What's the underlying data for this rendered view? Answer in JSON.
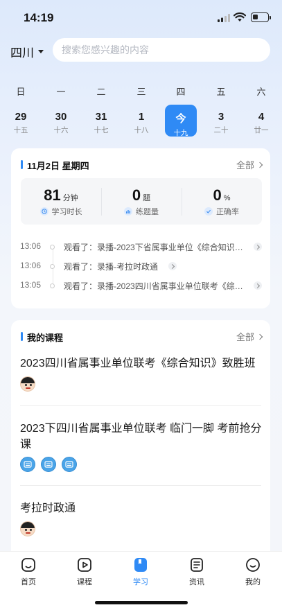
{
  "status_bar": {
    "time": "14:19"
  },
  "header": {
    "region": "四川",
    "search_placeholder": "搜索您感兴趣的内容"
  },
  "calendar": {
    "weekdays": [
      "日",
      "一",
      "二",
      "三",
      "四",
      "五",
      "六"
    ],
    "days": [
      {
        "day": "29",
        "lunar": "十五"
      },
      {
        "day": "30",
        "lunar": "十六"
      },
      {
        "day": "31",
        "lunar": "十七"
      },
      {
        "day": "1",
        "lunar": "十八"
      },
      {
        "day": "今",
        "lunar": "十九",
        "selected": true
      },
      {
        "day": "3",
        "lunar": "二十"
      },
      {
        "day": "4",
        "lunar": "廿一"
      }
    ]
  },
  "study_card": {
    "date_title": "11月2日  星期四",
    "all_label": "全部",
    "stats": [
      {
        "value": "81",
        "unit": "分钟",
        "label": "学习时长",
        "icon": "clock-icon"
      },
      {
        "value": "0",
        "unit": "题",
        "label": "练题量",
        "icon": "bar-chart-icon"
      },
      {
        "value": "0",
        "unit": "%",
        "label": "正确率",
        "icon": "check-icon"
      }
    ],
    "history": [
      {
        "time": "13:06",
        "text": "观看了：录播-2023下省属事业单位《综合知识》..."
      },
      {
        "time": "13:06",
        "text": "观看了：录播-考拉时政通"
      },
      {
        "time": "13:05",
        "text": "观看了：录播-2023四川省属事业单位联考《综合..."
      }
    ]
  },
  "courses_card": {
    "title": "我的课程",
    "all_label": "全部",
    "courses": [
      {
        "name": "2023四川省属事业单位联考《综合知识》致胜班",
        "avatars": [
          "kid"
        ]
      },
      {
        "name": "2023下四川省属事业单位联考 临门一脚 考前抢分课",
        "avatars": [
          "blue",
          "blue",
          "blue"
        ]
      },
      {
        "name": "考拉时政通",
        "avatars": [
          "kid"
        ]
      }
    ]
  },
  "tabbar": {
    "active": "学习",
    "tabs": [
      {
        "label": "首页",
        "icon": "home-icon"
      },
      {
        "label": "课程",
        "icon": "play-icon"
      },
      {
        "label": "学习",
        "icon": "book-icon"
      },
      {
        "label": "资讯",
        "icon": "news-icon"
      },
      {
        "label": "我的",
        "icon": "smile-icon"
      }
    ]
  },
  "colors": {
    "accent": "#2f8af5",
    "background_top": "#dde9fb",
    "card": "#ffffff"
  }
}
